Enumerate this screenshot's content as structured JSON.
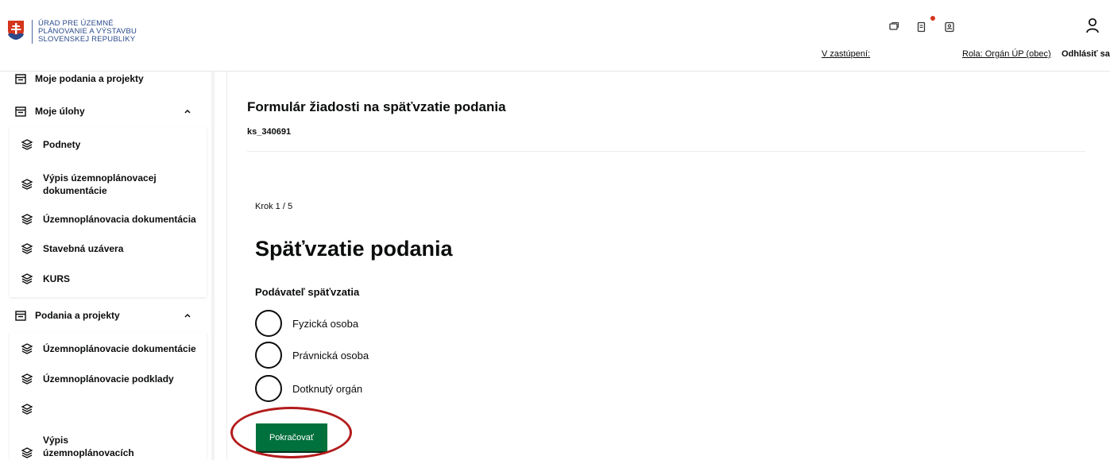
{
  "header": {
    "logo_lines": [
      "ÚRAD PRE ÚZEMNÉ",
      "PLÁNOVANIE A VÝSTAVBU",
      "SLOVENSKEJ REPUBLIKY"
    ],
    "icons": [
      "chat-icon",
      "document-notification-icon",
      "contact-card-icon",
      "user-icon"
    ],
    "delegation_link": "V zastúpení: ",
    "role_link": "Rola: Orgán ÚP (obec)",
    "logout": "Odhlásiť sa",
    "notification_color": "#d4351c"
  },
  "sidebar": {
    "top_item": "Moje podania a projekty",
    "group_tasks": {
      "label": "Moje úlohy",
      "items": [
        "Podnety",
        "Výpis územnoplánovacej dokumentácie",
        "Územnoplánovacia dokumentácia",
        "Stavebná uzávera",
        "KURS"
      ]
    },
    "group_submissions": {
      "label": "Podania a projekty",
      "items": [
        "Územnoplánovacie dokumentácie",
        "Územnoplánovacie podklady",
        "",
        "Výpis územnoplánovacích dokumentácií"
      ]
    }
  },
  "main": {
    "form_title": "Formulár žiadosti na späťvzatie podania",
    "form_code": "ks_340691",
    "step": "Krok 1 / 5",
    "heading": "Späťvzatie podania",
    "legend": "Podávateľ späťvzatia",
    "options": [
      "Fyzická osoba",
      "Právnická osoba",
      "Dotknutý orgán"
    ],
    "continue_button": "Pokračovať",
    "accent_color": "#00703c",
    "highlight_color": "#b31b1b"
  }
}
